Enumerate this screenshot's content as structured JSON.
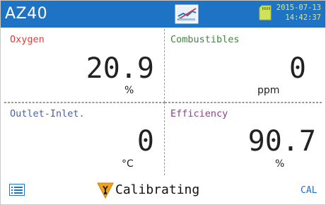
{
  "header": {
    "title": "AZ40",
    "date": "2015-07-13",
    "time": "14:42:37",
    "icons": {
      "status": "probe-status-icon",
      "storage": "sd-card-icon"
    },
    "colors": {
      "bar": "#1f73c4",
      "datetime": "#d7e98a"
    }
  },
  "readings": {
    "oxygen": {
      "label": "Oxygen",
      "value": "20.9",
      "unit": "%",
      "color": "#e23b3b"
    },
    "combustibles": {
      "label": "Combustibles",
      "value": "0",
      "unit": "ppm",
      "color": "#3c8a3c"
    },
    "outlet_inlet": {
      "label": "Outlet-Inlet.",
      "value": "0",
      "unit": "°C",
      "color": "#4a5fa8"
    },
    "efficiency": {
      "label": "Efficiency",
      "value": "90.7",
      "unit": "%",
      "color": "#8e3f8e"
    }
  },
  "footer": {
    "menu_icon": "menu-list-icon",
    "tool_icon": "wrench-warning-icon",
    "status": "Calibrating",
    "cal_label": "CAL",
    "cal_color": "#1f73c4"
  }
}
